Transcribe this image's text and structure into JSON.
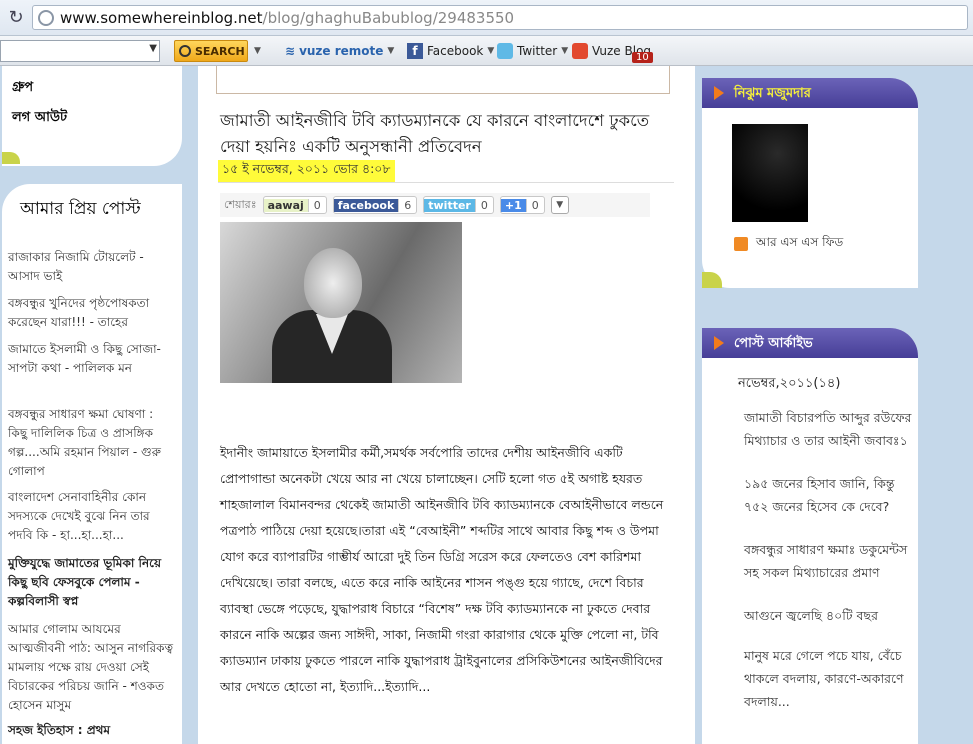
{
  "browser": {
    "url_host": "www.somewhereinblog.net",
    "url_path": "/blog/ghaghuBabublog/29483550"
  },
  "toolbar": {
    "search_label": "SEARCH",
    "vuze_label": "vuze remote",
    "facebook_label": "Facebook",
    "twitter_label": "Twitter",
    "vuze_blog_label": "Vuze Blog",
    "vuze_blog_badge": "10"
  },
  "left": {
    "menu": [
      "গ্রুপ",
      "লগ আউট"
    ],
    "fav_title": "আমার প্রিয় পোস্ট",
    "posts": [
      "রাজাকার নিজামি টোয়লেট - আসাদ ভাই",
      "বঙ্গবন্ধুর খুনিদের পৃষ্ঠপোষকতা করেছেন যারা!!! - তাহের",
      "  জামাতে ইসলামী ও কিছু সোজা-সাপটা কথা - পালিলক মন",
      "বঙ্গবন্ধুর সাধারণ ক্ষমা ঘোষণা : কিছু দালিলিক চিত্র ও প্রাসঙ্গিক গল্প....অমি রহমান পিয়াল - গুরু গোলাপ",
      "বাংলাদেশ সেনাবাহিনীর কোন সদস্যকে দেখেই বুঝে নিন তার পদবি কি - হা...হা...হা...",
      "মুক্তিযুদ্ধে জামাতের ভূমিকা নিয়ে কিছু ছবি ফেসবুকে পেলাম - কল্পবিলাসী স্বপ্ন",
      "আমার গোলাম আযমের আত্মজীবনী পাঠ: আসুন নাগরিকত্ব মামলায় পক্ষে রায় দেওয়া সেই বিচারকের পরিচয় জানি - শওকত হোসেন মাসুম",
      "সহজ ইতিহাস : প্রথম"
    ]
  },
  "post": {
    "title": "জামাতী আইনজীবি টবি ক্যাডম্যানকে যে কারনে বাংলাদেশে ঢুকতে দেয়া হয়নিঃ একটি অনুসন্ধানী প্রতিবেদন",
    "date": "১৫ ই নভেম্বর, ২০১১ ভোর ৪:০৮",
    "share_label": "শেয়ারঃ",
    "share": [
      {
        "name": "aawaj",
        "count": "0"
      },
      {
        "name": "facebook",
        "count": "6"
      },
      {
        "name": "twitter",
        "count": "0"
      },
      {
        "name": "+1",
        "count": "0"
      }
    ],
    "body": "ইদানীং জামায়াতে ইসলামীর কর্মী,সমর্থক সর্বপোরি তাদের দেশীয় আইনজীবি একটি প্রোপাগান্ডা অনেকটা খেয়ে আর না খেয়ে চালাচ্ছেন। সেটি হলো গত ৫ই অগাষ্ট হযরত শাহজালাল বিমানবন্দর থেকেই জামাতী আইনজীবি টবি ক্যাডম্যানকে বেআইনীভাবে লন্ডনে পত্রপাঠ পাঠিয়ে দেয়া হয়েছে।তারা এই “বেআইনী” শব্দটির সাথে আবার কিছু শব্দ ও উপমা যোগ করে ব্যাপারটির গাম্ভীর্য আরো দুই তিন ডিগ্রি সরেস করে ফেলতেও বেশ কারিশমা দেখিয়েছে। তারা বলছে, এতে করে নাকি আইনের শাসন পঙ্গু হয়ে গ্যাছে, দেশে বিচার ব্যাবস্থা ভেঙ্গে পড়েছে, যুদ্ধাপরাধ বিচারে “বিশেষ” দক্ষ টবি ক্যাডম্যানকে না ঢুকতে দেবার কারনে নাকি অল্পের জন্য সাঈদী, সাকা, নিজামী গংরা কারাগার থেকে মুক্তি পেলো না, টবি ক্যাডম্যান ঢাকায় ঢুকতে পারলে নাকি যুদ্ধাপরাধ ট্রাইবুনালের প্রসিকিউশনের আইনজীবিদের আর দেখতে হোতো না, ইত্যাদি...ইত্যাদি..."
  },
  "right": {
    "profile_title": "নিঝুম মজুমদার",
    "rss_label": "আর এস এস ফিড",
    "archive_title": "পোস্ট আর্কাইভ",
    "archive_month": "নভেম্বর,২০১১(১৪)",
    "archive_items": [
      "জামাতী বিচারপতি আব্দুর রউফের মিথ্যাচার ও তার আইনী জবাবঃ১",
      "১৯৫ জনের হিসাব জানি, কিন্তু ৭৫২ জনের হিসেব কে দেবে?",
      "বঙ্গবন্ধুর সাধারণ ক্ষমাঃ ডকুমেন্টস সহ সকল মিথ্যাচারের প্রমাণ",
      "আগুনে জ্বলেছি ৪০টি বছর",
      "মানুষ মরে গেলে পচে যায়, বেঁচে থাকলে বদলায়, কারণে-অকারণে বদলায়..."
    ]
  },
  "colors": {
    "page_bg": "#c5d8ea",
    "box_header": "#4f47a0",
    "highlight": "#fffb3a"
  }
}
